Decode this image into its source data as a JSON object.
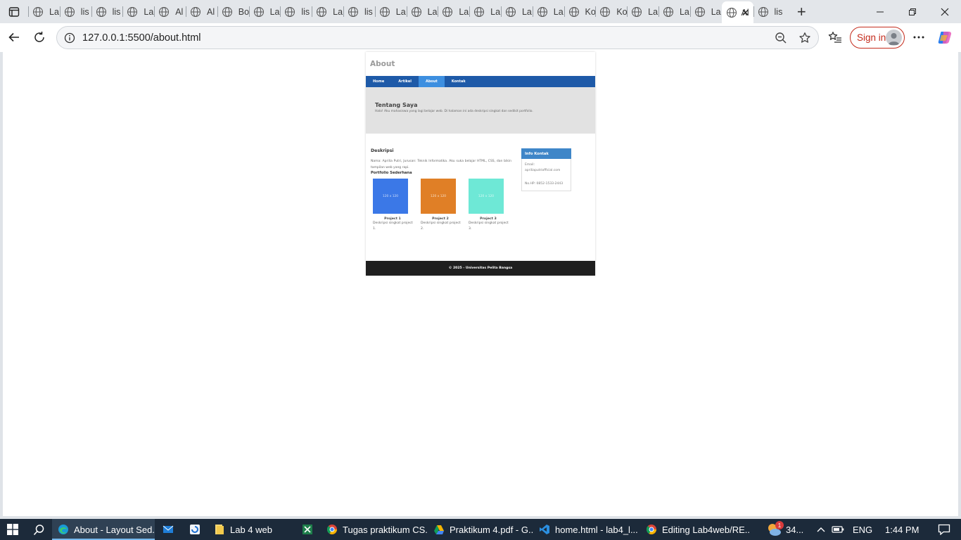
{
  "browser": {
    "tabs": [
      {
        "title": "La",
        "active": false
      },
      {
        "title": "lis",
        "active": false
      },
      {
        "title": "lis",
        "active": false
      },
      {
        "title": "La",
        "active": false
      },
      {
        "title": "Al",
        "active": false
      },
      {
        "title": "Al",
        "active": false
      },
      {
        "title": "Bo",
        "active": false
      },
      {
        "title": "La",
        "active": false
      },
      {
        "title": "lis",
        "active": false
      },
      {
        "title": "La",
        "active": false
      },
      {
        "title": "lis",
        "active": false
      },
      {
        "title": "La",
        "active": false
      },
      {
        "title": "La",
        "active": false
      },
      {
        "title": "La",
        "active": false
      },
      {
        "title": "La",
        "active": false
      },
      {
        "title": "La",
        "active": false
      },
      {
        "title": "La",
        "active": false
      },
      {
        "title": "Ko",
        "active": false
      },
      {
        "title": "Ko",
        "active": false
      },
      {
        "title": "La",
        "active": false
      },
      {
        "title": "La",
        "active": false
      },
      {
        "title": "La",
        "active": false
      },
      {
        "title": "Al",
        "active": true
      },
      {
        "title": "lis",
        "active": false
      }
    ],
    "new_tab": "+",
    "url": "127.0.0.1:5500/about.html",
    "sign_in_label": "Sign in"
  },
  "site": {
    "title": "About",
    "nav": [
      {
        "label": "Home",
        "active": false
      },
      {
        "label": "Artikel",
        "active": false
      },
      {
        "label": "About",
        "active": true
      },
      {
        "label": "Kontak",
        "active": false
      }
    ],
    "hero_title": "Tentang Saya",
    "hero_text": "Halo! Aku mahasiswa yang lagi belajar web. Di halaman ini ada deskripsi singkat dan sedikit portfolio.",
    "desc_title": "Deskripsi",
    "desc_text": "Nama: Aprilia Putri, Jurusan: Teknik Informatika. Aku suka belajar HTML, CSS, dan bikin tampilan web yang rapi.",
    "portfolio_title": "Portfolio Sederhana",
    "projects": [
      {
        "placeholder": "120 x 120",
        "title": "Project 1",
        "desc": "Deskripsi singkat project 1.",
        "color": "#3b78e7"
      },
      {
        "placeholder": "120 x 120",
        "title": "Project 2",
        "desc": "Deskripsi singkat project 2.",
        "color": "#e07f26"
      },
      {
        "placeholder": "120 x 120",
        "title": "Project 3",
        "desc": "Deskripsi singkat project 3.",
        "color": "#6ee8d6"
      }
    ],
    "contact": {
      "title": "Info Kontak",
      "email_label": "Email:",
      "email": "apriliaputriofficial.com",
      "phone": "No.HP: 0852-1533-2443"
    },
    "footer": "© 2025 - Universitas Pelita Bangsa"
  },
  "taskbar": {
    "apps": [
      {
        "label": "About - Layout Sed...",
        "active": true,
        "icon": "edge-icon"
      },
      {
        "label": "",
        "active": false,
        "icon": "mail-icon"
      },
      {
        "label": "",
        "active": false,
        "icon": "app-icon"
      },
      {
        "label": "Lab 4 web",
        "active": false,
        "icon": "folder-icon"
      },
      {
        "label": "",
        "active": false,
        "icon": "spreadsheet-icon"
      },
      {
        "label": "Tugas praktikum CS...",
        "active": false,
        "icon": "chrome-icon"
      },
      {
        "label": "Praktikum 4.pdf - G...",
        "active": false,
        "icon": "drive-icon"
      },
      {
        "label": "home.html - lab4_l...",
        "active": false,
        "icon": "vscode-icon"
      },
      {
        "label": "Editing Lab4web/RE...",
        "active": false,
        "icon": "chrome-icon"
      }
    ],
    "weather": "34...",
    "notification_count": "1",
    "language": "ENG",
    "time": "1:44 PM"
  }
}
